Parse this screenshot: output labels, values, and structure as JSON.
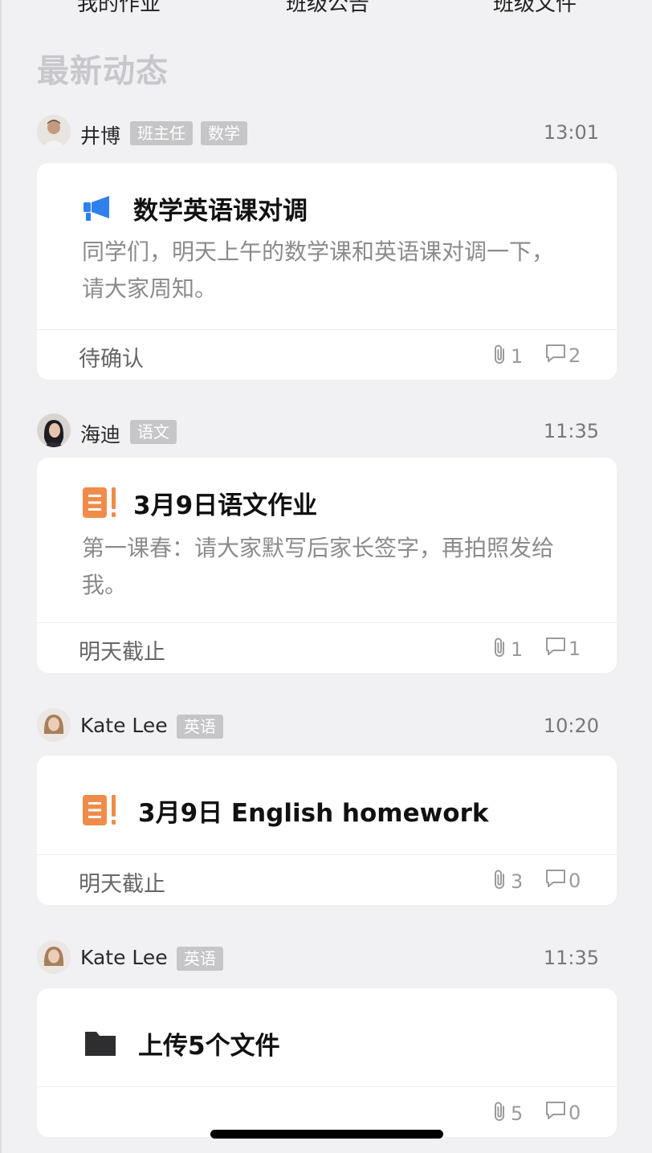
{
  "top_tabs": [
    "我的作业",
    "班级公告",
    "班级文件"
  ],
  "section_title": "最新动态",
  "feed": [
    {
      "author": "井博",
      "tags": [
        "班主任",
        "数学"
      ],
      "time": "13:01",
      "icon": "megaphone-icon",
      "title": "数学英语课对调",
      "body": [
        "同学们，明天上午的数学课和英语课对调一下，",
        "请大家周知。"
      ],
      "status": "待确认",
      "attachments": "1",
      "comments": "2"
    },
    {
      "author": "海迪",
      "tags": [
        "语文"
      ],
      "time": "11:35",
      "icon": "homework-icon",
      "title": "3月9日语文作业",
      "body": [
        "第一课春：请大家默写后家长签字，再拍照发给",
        "我。"
      ],
      "status": "明天截止",
      "attachments": "1",
      "comments": "1"
    },
    {
      "author": "Kate Lee",
      "tags": [
        "英语"
      ],
      "time": "10:20",
      "icon": "homework-icon",
      "title": "3月9日 English homework",
      "body": [],
      "status": "明天截止",
      "attachments": "3",
      "comments": "0"
    },
    {
      "author": "Kate Lee",
      "tags": [
        "英语"
      ],
      "time": "11:35",
      "icon": "folder-icon",
      "title": "上传5个文件",
      "body": [],
      "status": "",
      "attachments": "5",
      "comments": "0"
    }
  ],
  "colors": {
    "accent_blue": "#2f80ed",
    "homework_orange": "#f08c4a",
    "tag_gray": "#c6c6c8",
    "page_bg": "#f1f1f4"
  }
}
